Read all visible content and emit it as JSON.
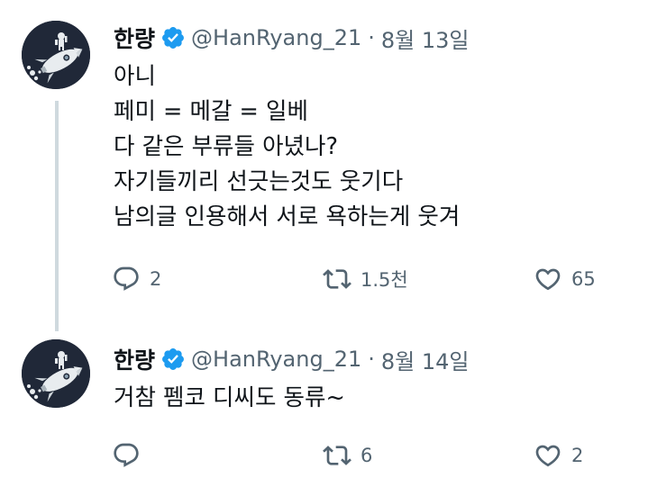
{
  "tweets": [
    {
      "name": "한량",
      "handle": "@HanRyang_21",
      "separator": "·",
      "date": "8월 13일",
      "lines": [
        "아니",
        "페미 = 메갈 = 일베",
        "다 같은 부류들 아녔나?",
        "자기들끼리 선긋는것도 웃기다",
        "남의글 인용해서 서로 욕하는게 웃겨"
      ],
      "replies": "2",
      "retweets": "1.5천",
      "likes": "65"
    },
    {
      "name": "한량",
      "handle": "@HanRyang_21",
      "separator": "·",
      "date": "8월 14일",
      "lines": [
        "거참 펨코 디씨도 동류~"
      ],
      "replies": "",
      "retweets": "6",
      "likes": "2"
    }
  ],
  "icons": {
    "avatar": "rocket-astronaut-avatar",
    "verified": "verified-badge-icon",
    "reply": "reply-icon",
    "retweet": "retweet-icon",
    "like": "heart-icon"
  },
  "colors": {
    "verified": "#1d9bf0",
    "secondary_text": "#536471",
    "thread_line": "#cfd9de",
    "avatar_bg": "#202838"
  }
}
